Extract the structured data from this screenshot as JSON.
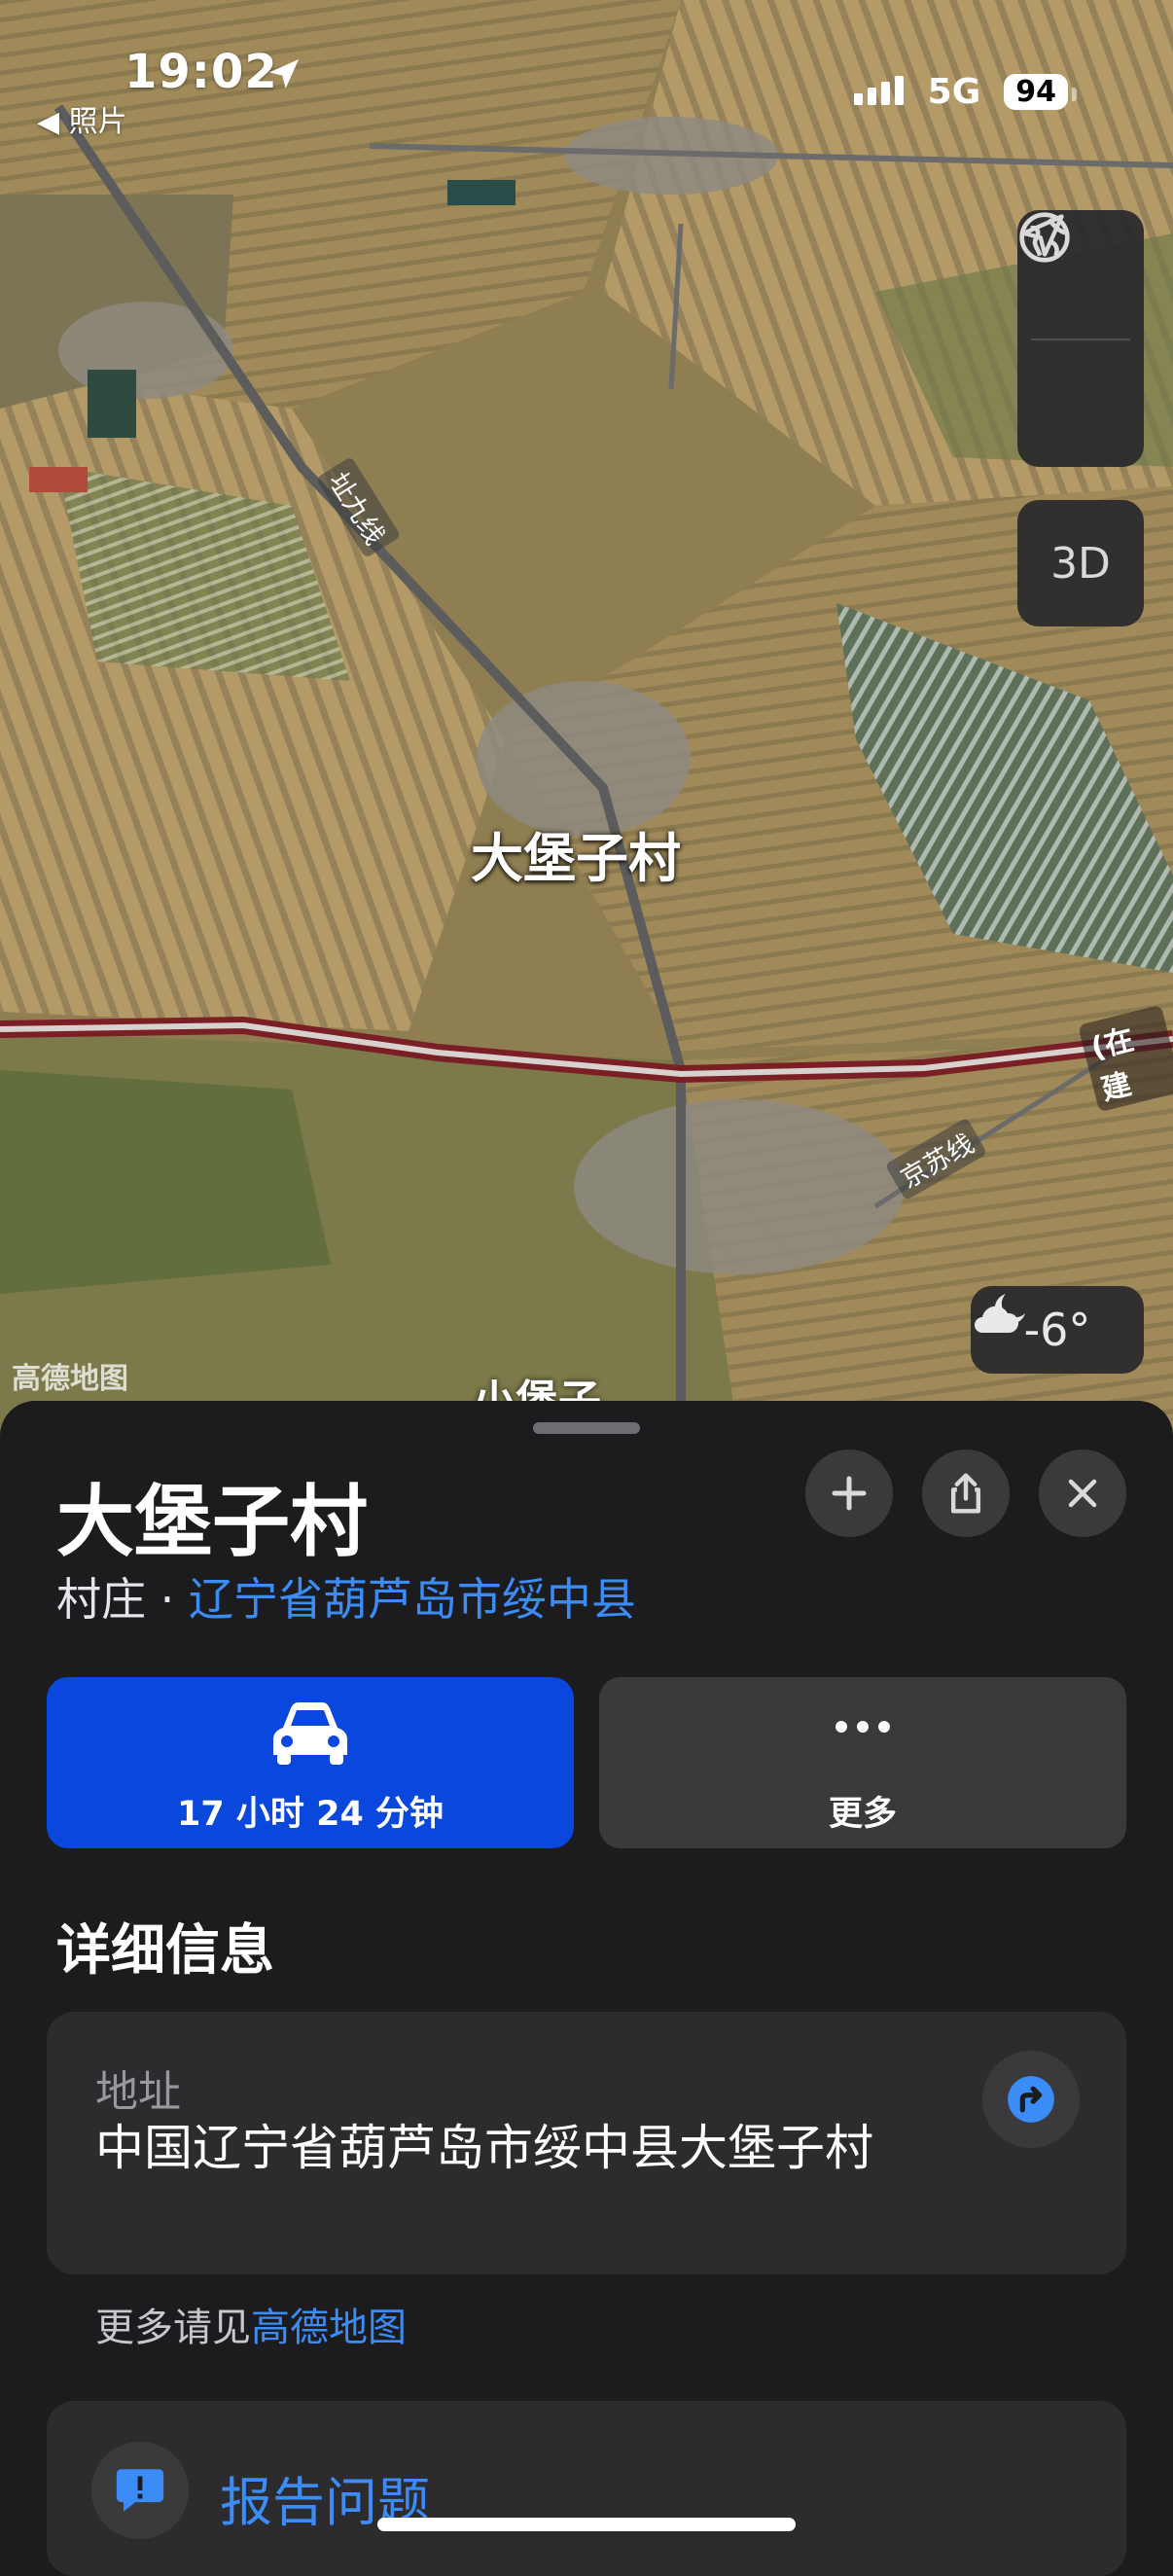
{
  "status_bar": {
    "time": "19:02",
    "back_app": "◀ 照片",
    "network": "5G",
    "battery": "94"
  },
  "map": {
    "village_label": "大堡子村",
    "road_label_1": "址九线",
    "road_label_2": "京苏线",
    "under_construction": "(在建",
    "nearby_label": "小堡子",
    "attribution": "高德地图",
    "three_d": "3D",
    "temperature": "-6°",
    "route_color": "#7a1f26"
  },
  "place": {
    "title": "大堡子村",
    "category": "村庄 · ",
    "region": "辽宁省葫芦岛市绥中县",
    "drive_time": "17 小时 24 分钟",
    "more_label": "更多"
  },
  "details": {
    "section_title": "详细信息",
    "address_label": "地址",
    "address_value": "中国辽宁省葫芦岛市绥中县大堡子村",
    "more_prefix": "更多请见",
    "more_link": "高德地图",
    "report_label": "报告问题"
  },
  "colors": {
    "accent": "#3b8cf6",
    "drive_button": "#0a47dc",
    "sheet_bg": "#1c1c1e",
    "card_bg": "#2c2c2e"
  }
}
